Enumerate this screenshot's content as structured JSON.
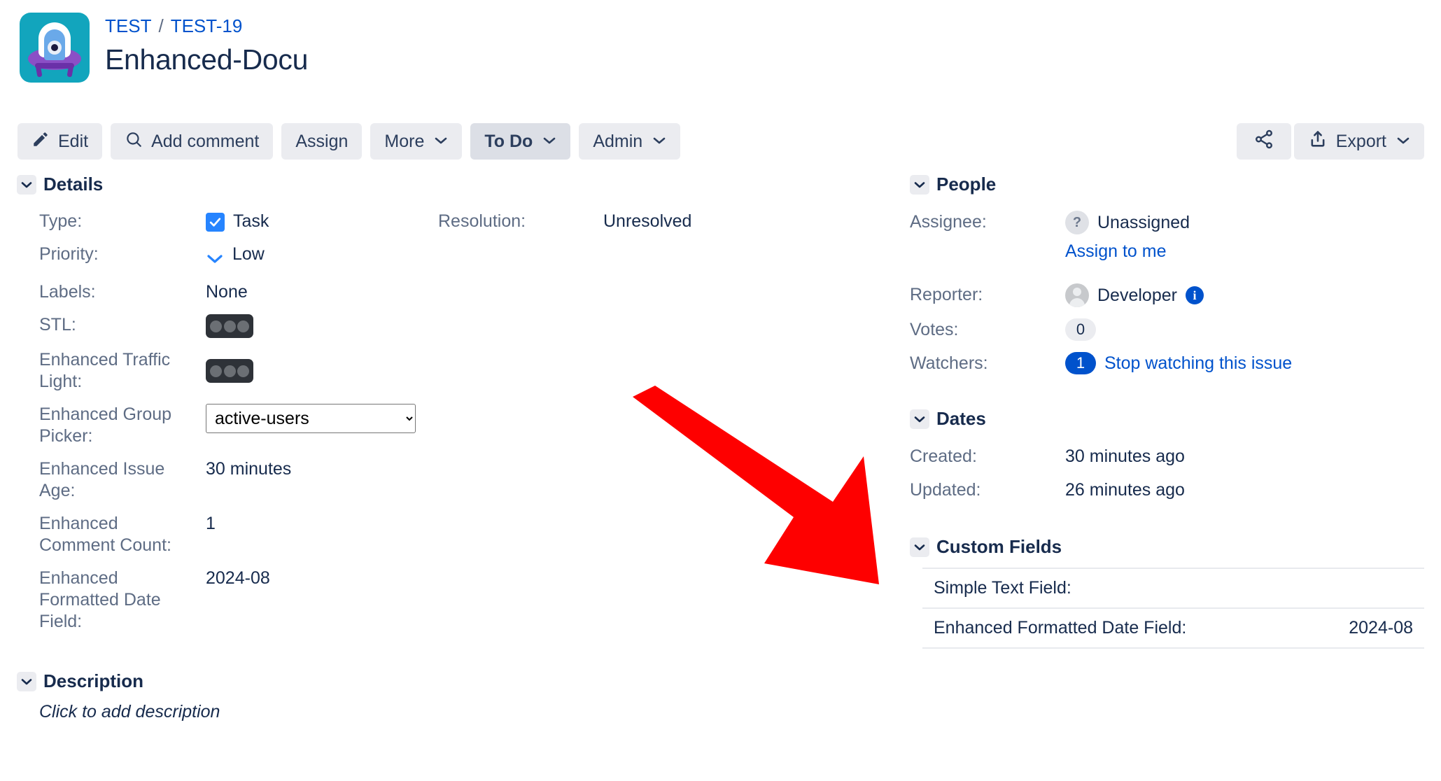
{
  "header": {
    "project_link": "TEST",
    "breadcrumb_separator": "/",
    "issue_key": "TEST-19",
    "title": "Enhanced-Docu"
  },
  "toolbar": {
    "edit": "Edit",
    "add_comment": "Add comment",
    "assign": "Assign",
    "more": "More",
    "status": "To Do",
    "admin": "Admin",
    "export": "Export"
  },
  "details": {
    "section_title": "Details",
    "fields": {
      "type_label": "Type:",
      "type_value": "Task",
      "priority_label": "Priority:",
      "priority_value": "Low",
      "labels_label": "Labels:",
      "labels_value": "None",
      "stl_label": "STL:",
      "enhanced_traffic_light_label": "Enhanced Traffic Light:",
      "enhanced_group_picker_label": "Enhanced Group Picker:",
      "enhanced_group_picker_value": "active-users",
      "enhanced_issue_age_label": "Enhanced Issue Age:",
      "enhanced_issue_age_value": "30 minutes",
      "enhanced_comment_count_label": "Enhanced Comment Count:",
      "enhanced_comment_count_value": "1",
      "enhanced_formatted_date_label": "Enhanced Formatted Date Field:",
      "enhanced_formatted_date_value": "2024-08",
      "resolution_label": "Resolution:",
      "resolution_value": "Unresolved"
    }
  },
  "description": {
    "section_title": "Description",
    "placeholder": "Click to add description"
  },
  "people": {
    "section_title": "People",
    "assignee_label": "Assignee:",
    "assignee_value": "Unassigned",
    "assign_to_me": "Assign to me",
    "reporter_label": "Reporter:",
    "reporter_value": "Developer",
    "votes_label": "Votes:",
    "votes_value": "0",
    "watchers_label": "Watchers:",
    "watchers_count": "1",
    "watchers_action": "Stop watching this issue"
  },
  "dates": {
    "section_title": "Dates",
    "created_label": "Created:",
    "created_value": "30 minutes ago",
    "updated_label": "Updated:",
    "updated_value": "26 minutes ago"
  },
  "custom_fields": {
    "section_title": "Custom Fields",
    "rows": [
      {
        "label": "Simple Text Field:",
        "value": ""
      },
      {
        "label": "Enhanced Formatted Date Field:",
        "value": "2024-08"
      }
    ]
  },
  "annotation": {
    "arrow_color": "#fe0000"
  },
  "colors": {
    "link": "#0052cc",
    "accent_blue": "#2684ff",
    "text": "#172b4d",
    "muted": "#5e6c84",
    "button_bg": "#ebecf0",
    "avatar_bg": "#12a5bd"
  }
}
